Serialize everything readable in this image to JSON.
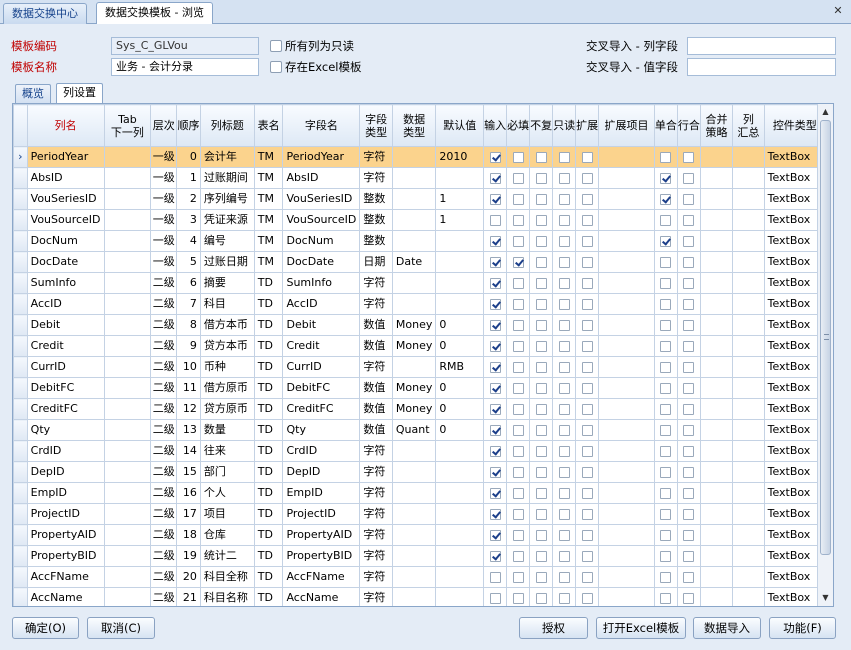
{
  "tabs": [
    "数据交换中心",
    "数据交换模板 - 浏览"
  ],
  "form": {
    "code_label": "模板编码",
    "code_value": "Sys_C_GLVou",
    "name_label": "模板名称",
    "name_value": "业务 - 会计分录",
    "all_readonly_label": "所有列为只读",
    "excel_template_label": "存在Excel模板",
    "cross_col_label": "交叉导入 - 列字段",
    "cross_val_label": "交叉导入 - 值字段"
  },
  "inner_tabs": [
    "概览",
    "列设置"
  ],
  "grid": {
    "headers": [
      "列名",
      "Tab\n下一列",
      "层次",
      "顺序",
      "列标题",
      "表名",
      "字段名",
      "字段\n类型",
      "数据\n类型",
      "默认值",
      "输入",
      "必填",
      "不复",
      "只读",
      "扩展",
      "扩展项目",
      "单合",
      "行合",
      "合并\n策略",
      "列\n汇总",
      "控件类型"
    ],
    "rows": [
      {
        "name": "PeriodYear",
        "level": "一级",
        "order": "0",
        "title": "会计年",
        "table": "TM",
        "field": "PeriodYear",
        "ftype": "字符",
        "dtype": "",
        "def": "2010",
        "input": true,
        "req": false,
        "nodup": false,
        "ro": false,
        "ext": false,
        "single": false,
        "rowm": false,
        "ctrl": "TextBox"
      },
      {
        "name": "AbsID",
        "level": "一级",
        "order": "1",
        "title": "过账期间",
        "table": "TM",
        "field": "AbsID",
        "ftype": "字符",
        "dtype": "",
        "def": "",
        "input": true,
        "req": false,
        "nodup": false,
        "ro": false,
        "ext": false,
        "single": true,
        "rowm": false,
        "ctrl": "TextBox"
      },
      {
        "name": "VouSeriesID",
        "level": "一级",
        "order": "2",
        "title": "序列编号",
        "table": "TM",
        "field": "VouSeriesID",
        "ftype": "整数",
        "dtype": "",
        "def": "1",
        "input": true,
        "req": false,
        "nodup": false,
        "ro": false,
        "ext": false,
        "single": true,
        "rowm": false,
        "ctrl": "TextBox"
      },
      {
        "name": "VouSourceID",
        "level": "一级",
        "order": "3",
        "title": "凭证来源",
        "table": "TM",
        "field": "VouSourceID",
        "ftype": "整数",
        "dtype": "",
        "def": "1",
        "input": false,
        "req": false,
        "nodup": false,
        "ro": false,
        "ext": false,
        "single": false,
        "rowm": false,
        "ctrl": "TextBox"
      },
      {
        "name": "DocNum",
        "level": "一级",
        "order": "4",
        "title": "编号",
        "table": "TM",
        "field": "DocNum",
        "ftype": "整数",
        "dtype": "",
        "def": "",
        "input": true,
        "req": false,
        "nodup": false,
        "ro": false,
        "ext": false,
        "single": true,
        "rowm": false,
        "ctrl": "TextBox"
      },
      {
        "name": "DocDate",
        "level": "一级",
        "order": "5",
        "title": "过账日期",
        "table": "TM",
        "field": "DocDate",
        "ftype": "日期",
        "dtype": "Date",
        "def": "",
        "input": true,
        "req": true,
        "nodup": false,
        "ro": false,
        "ext": false,
        "single": false,
        "rowm": false,
        "ctrl": "TextBox"
      },
      {
        "name": "SumInfo",
        "level": "二级",
        "order": "6",
        "title": "摘要",
        "table": "TD",
        "field": "SumInfo",
        "ftype": "字符",
        "dtype": "",
        "def": "",
        "input": true,
        "req": false,
        "nodup": false,
        "ro": false,
        "ext": false,
        "single": false,
        "rowm": false,
        "ctrl": "TextBox"
      },
      {
        "name": "AccID",
        "level": "二级",
        "order": "7",
        "title": "科目",
        "table": "TD",
        "field": "AccID",
        "ftype": "字符",
        "dtype": "",
        "def": "",
        "input": true,
        "req": false,
        "nodup": false,
        "ro": false,
        "ext": false,
        "single": false,
        "rowm": false,
        "ctrl": "TextBox"
      },
      {
        "name": "Debit",
        "level": "二级",
        "order": "8",
        "title": "借方本币",
        "table": "TD",
        "field": "Debit",
        "ftype": "数值",
        "dtype": "Money",
        "def": "0",
        "input": true,
        "req": false,
        "nodup": false,
        "ro": false,
        "ext": false,
        "single": false,
        "rowm": false,
        "ctrl": "TextBox"
      },
      {
        "name": "Credit",
        "level": "二级",
        "order": "9",
        "title": "贷方本币",
        "table": "TD",
        "field": "Credit",
        "ftype": "数值",
        "dtype": "Money",
        "def": "0",
        "input": true,
        "req": false,
        "nodup": false,
        "ro": false,
        "ext": false,
        "single": false,
        "rowm": false,
        "ctrl": "TextBox"
      },
      {
        "name": "CurrID",
        "level": "二级",
        "order": "10",
        "title": "币种",
        "table": "TD",
        "field": "CurrID",
        "ftype": "字符",
        "dtype": "",
        "def": "RMB",
        "input": true,
        "req": false,
        "nodup": false,
        "ro": false,
        "ext": false,
        "single": false,
        "rowm": false,
        "ctrl": "TextBox"
      },
      {
        "name": "DebitFC",
        "level": "二级",
        "order": "11",
        "title": "借方原币",
        "table": "TD",
        "field": "DebitFC",
        "ftype": "数值",
        "dtype": "Money",
        "def": "0",
        "input": true,
        "req": false,
        "nodup": false,
        "ro": false,
        "ext": false,
        "single": false,
        "rowm": false,
        "ctrl": "TextBox"
      },
      {
        "name": "CreditFC",
        "level": "二级",
        "order": "12",
        "title": "贷方原币",
        "table": "TD",
        "field": "CreditFC",
        "ftype": "数值",
        "dtype": "Money",
        "def": "0",
        "input": true,
        "req": false,
        "nodup": false,
        "ro": false,
        "ext": false,
        "single": false,
        "rowm": false,
        "ctrl": "TextBox"
      },
      {
        "name": "Qty",
        "level": "二级",
        "order": "13",
        "title": "数量",
        "table": "TD",
        "field": "Qty",
        "ftype": "数值",
        "dtype": "Quant",
        "def": "0",
        "input": true,
        "req": false,
        "nodup": false,
        "ro": false,
        "ext": false,
        "single": false,
        "rowm": false,
        "ctrl": "TextBox"
      },
      {
        "name": "CrdID",
        "level": "二级",
        "order": "14",
        "title": "往来",
        "table": "TD",
        "field": "CrdID",
        "ftype": "字符",
        "dtype": "",
        "def": "",
        "input": true,
        "req": false,
        "nodup": false,
        "ro": false,
        "ext": false,
        "single": false,
        "rowm": false,
        "ctrl": "TextBox"
      },
      {
        "name": "DepID",
        "level": "二级",
        "order": "15",
        "title": "部门",
        "table": "TD",
        "field": "DepID",
        "ftype": "字符",
        "dtype": "",
        "def": "",
        "input": true,
        "req": false,
        "nodup": false,
        "ro": false,
        "ext": false,
        "single": false,
        "rowm": false,
        "ctrl": "TextBox"
      },
      {
        "name": "EmpID",
        "level": "二级",
        "order": "16",
        "title": "个人",
        "table": "TD",
        "field": "EmpID",
        "ftype": "字符",
        "dtype": "",
        "def": "",
        "input": true,
        "req": false,
        "nodup": false,
        "ro": false,
        "ext": false,
        "single": false,
        "rowm": false,
        "ctrl": "TextBox"
      },
      {
        "name": "ProjectID",
        "level": "二级",
        "order": "17",
        "title": "项目",
        "table": "TD",
        "field": "ProjectID",
        "ftype": "字符",
        "dtype": "",
        "def": "",
        "input": true,
        "req": false,
        "nodup": false,
        "ro": false,
        "ext": false,
        "single": false,
        "rowm": false,
        "ctrl": "TextBox"
      },
      {
        "name": "PropertyAID",
        "level": "二级",
        "order": "18",
        "title": "仓库",
        "table": "TD",
        "field": "PropertyAID",
        "ftype": "字符",
        "dtype": "",
        "def": "",
        "input": true,
        "req": false,
        "nodup": false,
        "ro": false,
        "ext": false,
        "single": false,
        "rowm": false,
        "ctrl": "TextBox"
      },
      {
        "name": "PropertyBID",
        "level": "二级",
        "order": "19",
        "title": "统计二",
        "table": "TD",
        "field": "PropertyBID",
        "ftype": "字符",
        "dtype": "",
        "def": "",
        "input": true,
        "req": false,
        "nodup": false,
        "ro": false,
        "ext": false,
        "single": false,
        "rowm": false,
        "ctrl": "TextBox"
      },
      {
        "name": "AccFName",
        "level": "二级",
        "order": "20",
        "title": "科目全称",
        "table": "TD",
        "field": "AccFName",
        "ftype": "字符",
        "dtype": "",
        "def": "",
        "input": false,
        "req": false,
        "nodup": false,
        "ro": false,
        "ext": false,
        "single": false,
        "rowm": false,
        "ctrl": "TextBox"
      },
      {
        "name": "AccName",
        "level": "二级",
        "order": "21",
        "title": "科目名称",
        "table": "TD",
        "field": "AccName",
        "ftype": "字符",
        "dtype": "",
        "def": "",
        "input": false,
        "req": false,
        "nodup": false,
        "ro": false,
        "ext": false,
        "single": false,
        "rowm": false,
        "ctrl": "TextBox"
      }
    ]
  },
  "buttons": {
    "ok": "确定(O)",
    "cancel": "取消(C)",
    "auth": "授权",
    "open_excel": "打开Excel模板",
    "import": "数据导入",
    "func": "功能(F)"
  }
}
